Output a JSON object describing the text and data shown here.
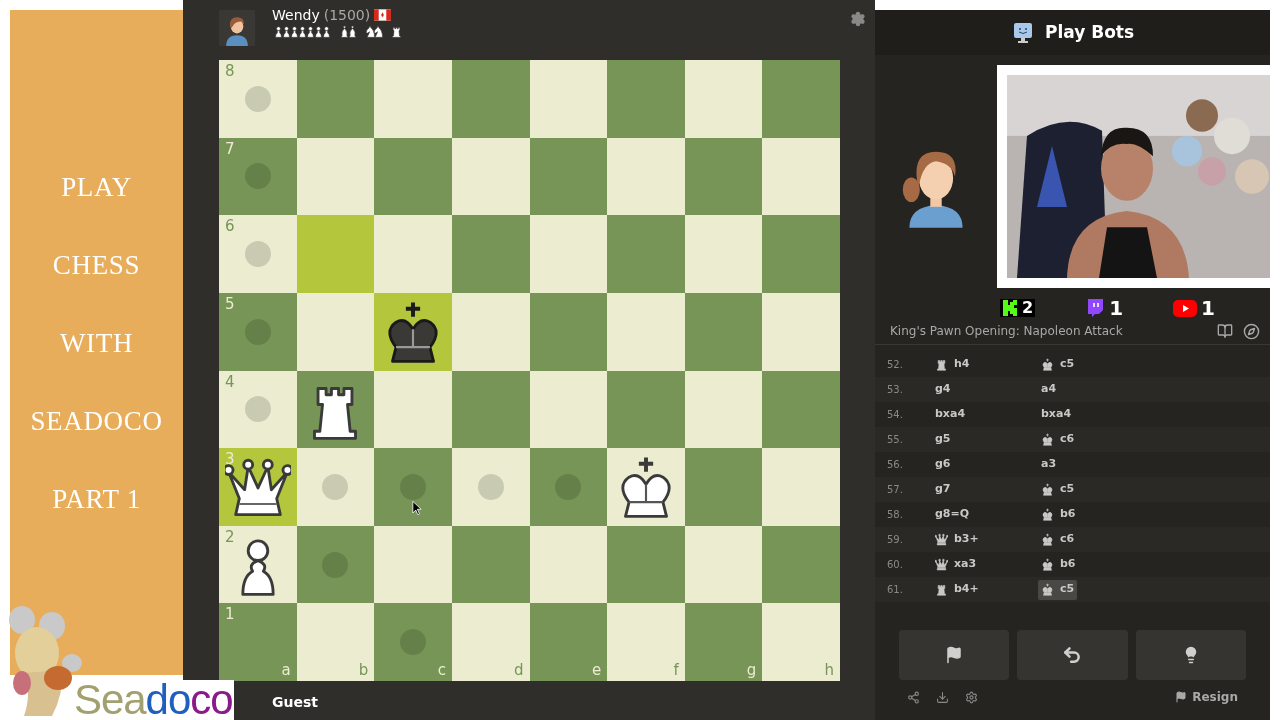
{
  "banner": {
    "lines": [
      "PLAY",
      "CHESS",
      "WITH",
      "SEADOCO",
      "PART 1"
    ]
  },
  "logo": {
    "parts": [
      {
        "text": "Sea",
        "color": "#a3a070"
      },
      {
        "text": "do",
        "color": "#1f5fc0"
      },
      {
        "text": "co",
        "color": "#8a1a8a"
      }
    ]
  },
  "opponent": {
    "name": "Wendy",
    "rating": "(1500)",
    "captured": [
      {
        "kind": "pawn"
      },
      {
        "kind": "pawn"
      },
      {
        "kind": "pawn"
      },
      {
        "kind": "pawn"
      },
      {
        "kind": "pawn"
      },
      {
        "kind": "pawn"
      },
      {
        "kind": "pawn"
      },
      {
        "kind": "bishop"
      },
      {
        "kind": "bishop"
      },
      {
        "kind": "knight"
      },
      {
        "kind": "knight"
      },
      {
        "kind": "rook"
      }
    ]
  },
  "board": {
    "ranks": [
      "8",
      "7",
      "6",
      "5",
      "4",
      "3",
      "2",
      "1"
    ],
    "files": [
      "a",
      "b",
      "c",
      "d",
      "e",
      "f",
      "g",
      "h"
    ],
    "squares": [
      [
        {
          "highlighted": false,
          "hint": true
        },
        {
          "highlighted": false,
          "hint": false
        },
        {
          "highlighted": false,
          "hint": false
        },
        {
          "highlighted": false,
          "hint": false
        },
        {
          "highlighted": false,
          "hint": false
        },
        {
          "highlighted": false,
          "hint": false
        },
        {
          "highlighted": false,
          "hint": false
        },
        {
          "highlighted": false,
          "hint": false
        }
      ],
      [
        {
          "highlighted": false,
          "hint": true
        },
        {
          "highlighted": false,
          "hint": false
        },
        {
          "highlighted": false,
          "hint": false
        },
        {
          "highlighted": false,
          "hint": false
        },
        {
          "highlighted": false,
          "hint": false
        },
        {
          "highlighted": false,
          "hint": false
        },
        {
          "highlighted": false,
          "hint": false
        },
        {
          "highlighted": false,
          "hint": false
        }
      ],
      [
        {
          "highlighted": false,
          "hint": true
        },
        {
          "highlighted": true,
          "hint": false
        },
        {
          "highlighted": false,
          "hint": false
        },
        {
          "highlighted": false,
          "hint": false
        },
        {
          "highlighted": false,
          "hint": false
        },
        {
          "highlighted": false,
          "hint": false
        },
        {
          "highlighted": false,
          "hint": false
        },
        {
          "highlighted": false,
          "hint": false
        }
      ],
      [
        {
          "highlighted": false,
          "hint": true
        },
        {
          "highlighted": false,
          "hint": false
        },
        {
          "highlighted": true,
          "hint": false,
          "piece": {
            "kind": "king",
            "black": true
          }
        },
        {
          "highlighted": false,
          "hint": false
        },
        {
          "highlighted": false,
          "hint": false
        },
        {
          "highlighted": false,
          "hint": false
        },
        {
          "highlighted": false,
          "hint": false
        },
        {
          "highlighted": false,
          "hint": false
        }
      ],
      [
        {
          "highlighted": false,
          "hint": true
        },
        {
          "highlighted": false,
          "hint": false,
          "piece": {
            "kind": "rook",
            "black": false
          }
        },
        {
          "highlighted": false,
          "hint": false
        },
        {
          "highlighted": false,
          "hint": false
        },
        {
          "highlighted": false,
          "hint": false
        },
        {
          "highlighted": false,
          "hint": false
        },
        {
          "highlighted": false,
          "hint": false
        },
        {
          "highlighted": false,
          "hint": false
        }
      ],
      [
        {
          "highlighted": true,
          "hint": false,
          "piece": {
            "kind": "queen",
            "black": false
          }
        },
        {
          "highlighted": false,
          "hint": true
        },
        {
          "highlighted": false,
          "hint": true
        },
        {
          "highlighted": false,
          "hint": true
        },
        {
          "highlighted": false,
          "hint": true
        },
        {
          "highlighted": false,
          "hint": false,
          "piece": {
            "kind": "king",
            "black": false
          }
        },
        {
          "highlighted": false,
          "hint": false
        },
        {
          "highlighted": false,
          "hint": false
        }
      ],
      [
        {
          "highlighted": false,
          "hint": false,
          "piece": {
            "kind": "pawn",
            "black": false
          }
        },
        {
          "highlighted": false,
          "hint": true
        },
        {
          "highlighted": false,
          "hint": false
        },
        {
          "highlighted": false,
          "hint": false
        },
        {
          "highlighted": false,
          "hint": false
        },
        {
          "highlighted": false,
          "hint": false
        },
        {
          "highlighted": false,
          "hint": false
        },
        {
          "highlighted": false,
          "hint": false
        }
      ],
      [
        {
          "highlighted": false,
          "hint": false
        },
        {
          "highlighted": false,
          "hint": false
        },
        {
          "highlighted": false,
          "hint": true
        },
        {
          "highlighted": false,
          "hint": false
        },
        {
          "highlighted": false,
          "hint": false
        },
        {
          "highlighted": false,
          "hint": false
        },
        {
          "highlighted": false,
          "hint": false
        },
        {
          "highlighted": false,
          "hint": false
        }
      ]
    ]
  },
  "player": {
    "name": "Guest"
  },
  "panel": {
    "title": "Play Bots",
    "opening": "King's Pawn Opening: Napoleon Attack",
    "stream_counts": [
      {
        "kind": "kick",
        "count": "2"
      },
      {
        "kind": "twitch",
        "count": "1"
      },
      {
        "kind": "youtube",
        "count": "1"
      }
    ],
    "moves": [
      {
        "number": "52.",
        "white": {
          "kind": "rook",
          "san": "h4",
          "selected": false
        },
        "black": {
          "kind": "king",
          "san": "c5",
          "selected": false
        }
      },
      {
        "number": "53.",
        "white": {
          "san": "g4",
          "selected": false
        },
        "black": {
          "san": "a4",
          "selected": false
        }
      },
      {
        "number": "54.",
        "white": {
          "san": "bxa4",
          "selected": false
        },
        "black": {
          "san": "bxa4",
          "selected": false
        }
      },
      {
        "number": "55.",
        "white": {
          "san": "g5",
          "selected": false
        },
        "black": {
          "kind": "king",
          "san": "c6",
          "selected": false
        }
      },
      {
        "number": "56.",
        "white": {
          "san": "g6",
          "selected": false
        },
        "black": {
          "san": "a3",
          "selected": false
        }
      },
      {
        "number": "57.",
        "white": {
          "san": "g7",
          "selected": false
        },
        "black": {
          "kind": "king",
          "san": "c5",
          "selected": false
        }
      },
      {
        "number": "58.",
        "white": {
          "san": "g8=Q",
          "selected": false
        },
        "black": {
          "kind": "king",
          "san": "b6",
          "selected": false
        }
      },
      {
        "number": "59.",
        "white": {
          "kind": "queen",
          "san": "b3+",
          "selected": false
        },
        "black": {
          "kind": "king",
          "san": "c6",
          "selected": false
        }
      },
      {
        "number": "60.",
        "white": {
          "kind": "queen",
          "san": "xa3",
          "selected": false
        },
        "black": {
          "kind": "king",
          "san": "b6",
          "selected": false
        }
      },
      {
        "number": "61.",
        "white": {
          "kind": "rook",
          "san": "b4+",
          "selected": false
        },
        "black": {
          "kind": "king",
          "san": "c5",
          "selected": true
        }
      }
    ],
    "resign": "Resign"
  }
}
